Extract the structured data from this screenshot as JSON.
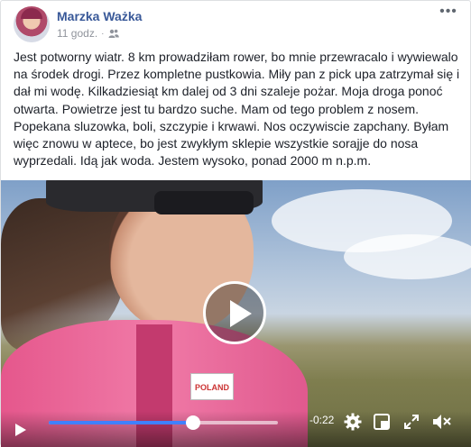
{
  "post": {
    "author": "Marzka Ważka",
    "time": "11 godz.",
    "audience_icon": "friends-icon",
    "more_icon": "more-horizontal-icon",
    "text": "Jest potworny wiatr. 8 km prowadziłam rower, bo mnie przewracalo i wywiewalo na środek drogi. Przez kompletne pustkowia. Miły pan z pick upa zatrzymał się i dał mi wodę. Kilkadziesiąt km dalej od 3 dni szaleje pożar. Moja droga ponoć otwarta. Powietrze jest tu bardzo suche. Mam od tego problem z nosem. Popekana sluzowka, boli, szczypie i krwawi. Nos oczywiscie zapchany. Byłam więc znowu w aptece, bo jest zwykłym sklepie wszystkie sorajje do nosa wyprzedali. Idą jak woda. Jestem wysoko, ponad 2000 m n.p.m."
  },
  "video": {
    "jersey_flag_text": "POLAND",
    "time_remaining": "-0:22",
    "progress": 0.63,
    "accent": "#4080ff",
    "controls": {
      "play_icon": "play-icon",
      "settings_icon": "gear-icon",
      "pip_icon": "picture-in-picture-icon",
      "fullscreen_icon": "fullscreen-icon",
      "mute_icon": "speaker-muted-icon"
    }
  }
}
